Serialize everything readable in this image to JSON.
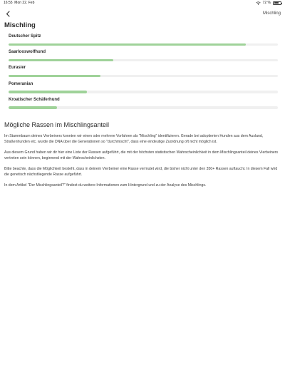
{
  "status_bar": {
    "time": "16:55",
    "date": "Mon 22. Feb",
    "battery_percent": "72 %",
    "battery_level": 0.72
  },
  "nav": {
    "title": "Mischling"
  },
  "section": {
    "title": "Mischling"
  },
  "breeds": [
    {
      "name": "Deutscher Spitz",
      "fraction": 0.88
    },
    {
      "name": "Saarlooswolfhund",
      "fraction": 0.39
    },
    {
      "name": "Eurasier",
      "fraction": 0.34
    },
    {
      "name": "Pomeranian",
      "fraction": 0.29
    },
    {
      "name": "Kroatischer Schäferhund",
      "fraction": 0.18
    }
  ],
  "info": {
    "title": "Mögliche Rassen im Mischlingsanteil",
    "paragraphs": [
      "Im Stammbaum deines Vierbeiners konnten wir einen oder mehrere Vorfahren als \"Mischling\" identifizieren. Gerade bei adoptierten Hunden aus dem Ausland, Straßenhunden etc. wurde die DNA über die Generationen so \"durchmischt\", dass eine eindeutige Zuordnung oft nicht möglich ist.",
      "Aus diesem Grund haben wir dir hier eine Liste der Rassen aufgeführt, die mit der höchsten statistischen Wahrscheinlichkeit in dem Mischlingsanteil deines Vierbeiners vertreten sein können, beginnend mit der Wahrscheinlichsten.",
      "Bitte beachte, dass die Möglichkeit besteht, dass in deinem Vierbeiner eine Rasse vermutet wird, die bisher nicht unter den 350+ Rassen auftaucht. In diesem Fall wird die genetisch nächstliegende Rasse aufgeführt.",
      "In dem Artikel \"Der Mischlingsanteil?\" findest du weitere Informationen zum Hintergrund und zu der Analyse des Mischlings."
    ]
  },
  "colors": {
    "bar_fill": "#9fd299",
    "bar_track": "#f0f0f0"
  },
  "icons": {
    "back": "chevron-left-icon",
    "wifi": "wifi-icon",
    "battery": "battery-icon"
  }
}
